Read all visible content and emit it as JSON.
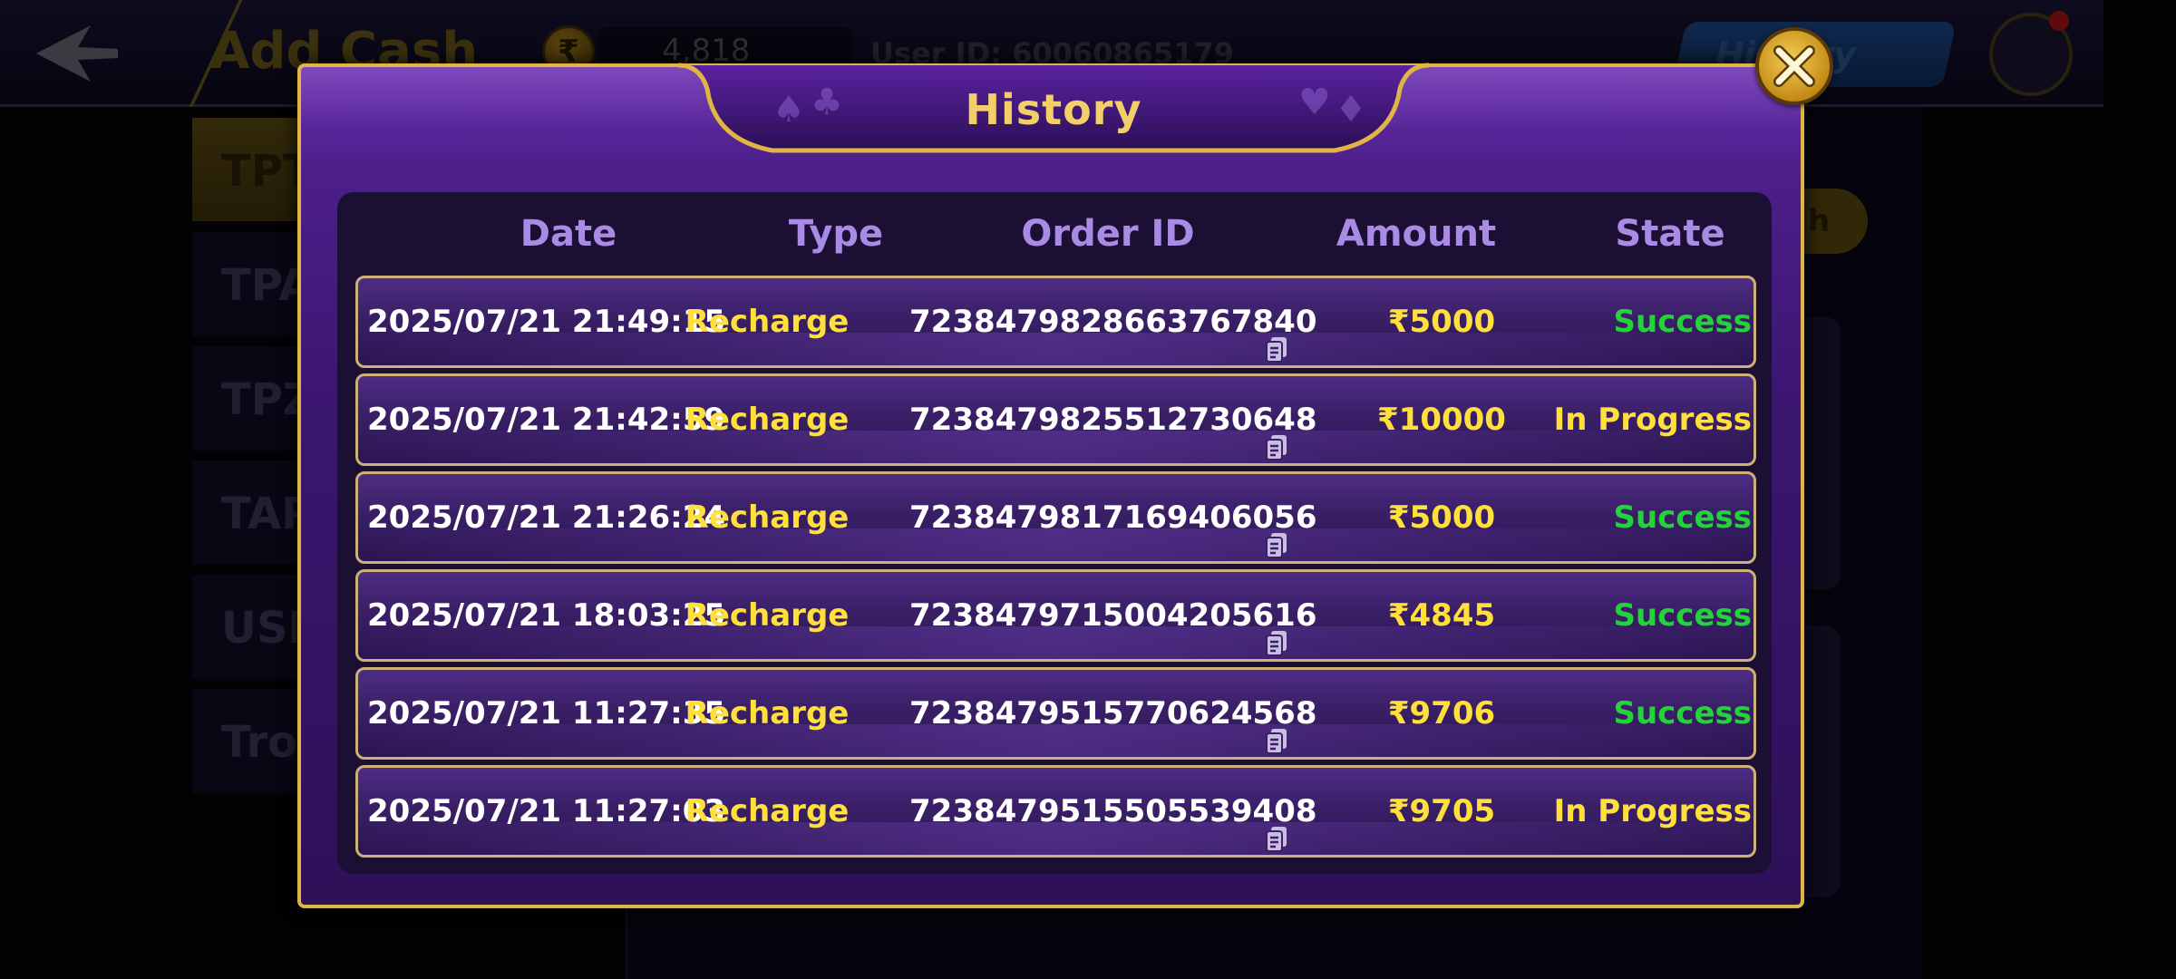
{
  "header": {
    "title": "Add Cash",
    "coin_symbol": "₹",
    "balance": "4,818",
    "user_id": "User ID: 60060865179",
    "history_button": "History"
  },
  "sidebar": {
    "items": [
      {
        "label": "TPT"
      },
      {
        "label": "TPA"
      },
      {
        "label": "TPZ"
      },
      {
        "label": "TAP"
      },
      {
        "label": "USD"
      },
      {
        "label": "Tro"
      }
    ]
  },
  "gold_tab_label": "h",
  "modal": {
    "title": "History",
    "columns": [
      "Date",
      "Type",
      "Order ID",
      "Amount",
      "State"
    ],
    "rows": [
      {
        "date": "2025/07/21 21:49:15",
        "type": "Recharge",
        "order_id": "7238479828663767840",
        "amount": "₹5000",
        "state": "Success"
      },
      {
        "date": "2025/07/21 21:42:59",
        "type": "Recharge",
        "order_id": "7238479825512730648",
        "amount": "₹10000",
        "state": "In Progress"
      },
      {
        "date": "2025/07/21 21:26:24",
        "type": "Recharge",
        "order_id": "7238479817169406056",
        "amount": "₹5000",
        "state": "Success"
      },
      {
        "date": "2025/07/21 18:03:25",
        "type": "Recharge",
        "order_id": "7238479715004205616",
        "amount": "₹4845",
        "state": "Success"
      },
      {
        "date": "2025/07/21 11:27:35",
        "type": "Recharge",
        "order_id": "7238479515770624568",
        "amount": "₹9706",
        "state": "Success"
      },
      {
        "date": "2025/07/21 11:27:03",
        "type": "Recharge",
        "order_id": "7238479515505539408",
        "amount": "₹9705",
        "state": "In Progress"
      }
    ],
    "state_colors": {
      "Success": "#22d33a",
      "In Progress": "#ffe03a"
    },
    "accent_gold": "#e0b545",
    "panel_purple": "#3b1670"
  },
  "icons": {
    "back": "back-arrow-icon",
    "coin": "coin-icon",
    "close": "close-icon",
    "copy": "copy-icon",
    "support": "support-agent-icon"
  }
}
